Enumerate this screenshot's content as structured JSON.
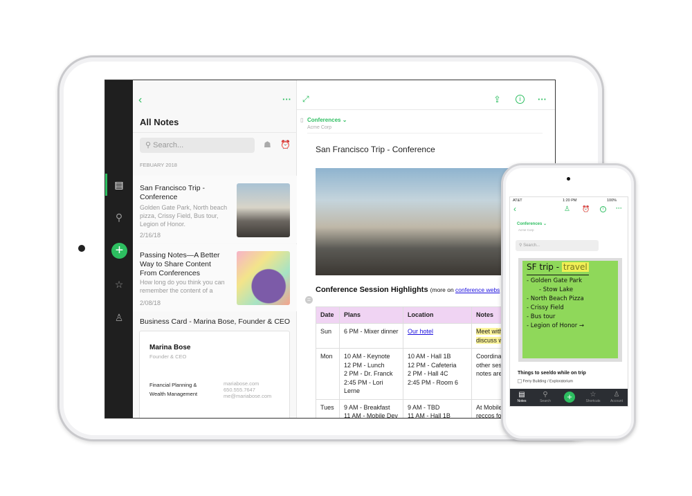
{
  "ipad": {
    "sidebar": {
      "items": [
        {
          "icon": "notes-icon"
        },
        {
          "icon": "search-icon"
        },
        {
          "icon": "plus-icon"
        },
        {
          "icon": "star-icon"
        },
        {
          "icon": "account-icon"
        }
      ]
    },
    "list": {
      "title": "All Notes",
      "search_placeholder": "Search...",
      "section": "FEBUARY 2018",
      "notes": [
        {
          "title": "San Francisco Trip - Conference",
          "snippet": "Golden Gate Park, North beach pizza, Crissy Field, Bus tour, Legion of Honor.",
          "date": "2/16/18"
        },
        {
          "title": "Passing Notes—A Better Way to Share Content From Conferences",
          "snippet": "How long do you think you can remember the content of a",
          "date": "2/08/18"
        }
      ],
      "card_note": {
        "title": "Business Card - Marina Bose, Founder & CEO",
        "name": "Marina Bose",
        "role": "Founder & CEO",
        "company_line1": "Financial Planning &",
        "company_line2": "Wealth Management",
        "web": "mariabose.com",
        "phone": "650.555.7647",
        "email": "me@mariabose.com"
      }
    },
    "editor": {
      "notebook": "Conferences",
      "workspace": "Acme Corp",
      "title": "San Francisco Trip - Conference",
      "section_heading": "Conference Session Highlights",
      "section_more_prefix": "(more on ",
      "section_link": "conference webs",
      "table": {
        "headers": [
          "Date",
          "Plans",
          "Location",
          "Notes"
        ],
        "rows": [
          {
            "date": "Sun",
            "plans": [
              "6 PM - Mixer dinner"
            ],
            "location": [
              "Our hotel"
            ],
            "notes": [
              "Meet with",
              "discuss w"
            ]
          },
          {
            "date": "Mon",
            "plans": [
              "10 AM - Keynote",
              "12 PM - Lunch",
              "2 PM - Dr. Franck",
              "2:45 PM - Lori Lerne"
            ],
            "location": [
              "10 AM - Hall 1B",
              "12 PM - Cafeteria",
              "2 PM - Hall 4C",
              "2:45 PM - Room 6"
            ],
            "notes": [
              "Coordinat",
              "other sess",
              "notes are"
            ]
          },
          {
            "date": "Tues",
            "plans": [
              "9 AM - Breakfast",
              "11 AM - Mobile Dev"
            ],
            "location": [
              "9 AM - TBD",
              "11 AM - Hall 1B"
            ],
            "notes": [
              "At Mobile",
              "reccos for"
            ]
          }
        ]
      }
    }
  },
  "iphone": {
    "status": {
      "carrier": "AT&T",
      "time": "1:20 PM",
      "battery": "100%"
    },
    "notebook": "Conferences",
    "workspace": "Acme Corp",
    "search_placeholder": "Search...",
    "sticky": {
      "line1": "SF trip -",
      "highlight": "travel",
      "items": [
        "- Golden Gate Park",
        "- Stow Lake",
        "- North Beach Pizza",
        "- Crissy Field",
        "- Bus tour",
        "- Legion of Honor →"
      ]
    },
    "checklist_title": "Things to see/do while on trip",
    "checklist": [
      {
        "label": "Ferry Building / Exploratorium",
        "checked": false
      }
    ],
    "tabs": [
      {
        "label": "Notes",
        "icon": "notes-icon"
      },
      {
        "label": "Search",
        "icon": "search-icon"
      },
      {
        "label": "",
        "icon": "plus-icon"
      },
      {
        "label": "Shortcuts",
        "icon": "star-icon"
      },
      {
        "label": "Account",
        "icon": "account-icon"
      }
    ]
  },
  "colors": {
    "accent": "#2dbe60",
    "table_header": "#f0d4f3",
    "highlight": "#fdf59a",
    "sidebar": "#1f1f1f"
  }
}
